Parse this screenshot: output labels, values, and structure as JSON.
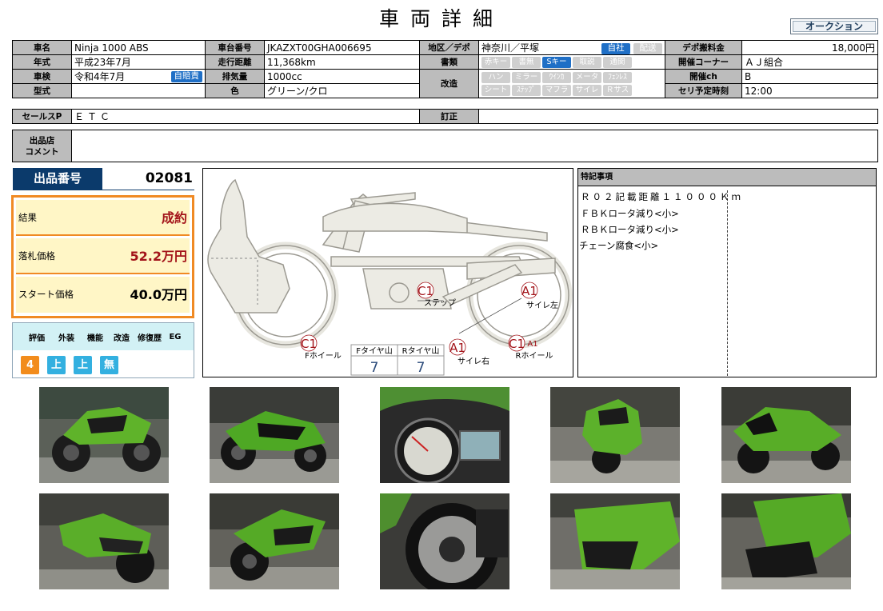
{
  "header": {
    "title": "車両詳細",
    "auction_button": "オークション"
  },
  "spec": {
    "name_label": "車名",
    "name": "Ninja 1000 ABS",
    "chassis_label": "車台番号",
    "chassis": "JKAZXT00GHA006695",
    "region_label": "地区／デポ",
    "region": "神奈川／平塚",
    "own_tag": "自社",
    "delivery_tag": "配送",
    "depo_fee_label": "デポ搬料金",
    "depo_fee": "18,000円",
    "year_label": "年式",
    "year": "平成23年7月",
    "mileage_label": "走行距離",
    "mileage": "11,368km",
    "docs_label": "書類",
    "docs_tags": [
      {
        "label": "赤キー",
        "on": false
      },
      {
        "label": "書無",
        "on": false
      },
      {
        "label": "Sキー",
        "on": true
      },
      {
        "label": "取説",
        "on": false
      },
      {
        "label": "通関",
        "on": false
      }
    ],
    "corner_label": "開催コーナー",
    "corner": "ＡＪ組合",
    "inspection_label": "車検",
    "inspection": "令和4年7月",
    "insurance_tag": "自賠責",
    "displacement_label": "排気量",
    "displacement": "1000cc",
    "mod_label": "改造",
    "mod_tags_row1": [
      "ハン",
      "ミラー",
      "ｳｲﾝｶ",
      "メータ",
      "ﾌｪﾝﾚｽ"
    ],
    "mod_tags_row2": [
      "シート",
      "ｽﾃｯﾌﾟ",
      "マフラ",
      "サイレ",
      "Ｒサス"
    ],
    "channel_label": "開催ch",
    "channel": "B",
    "model_label": "型式",
    "model": "",
    "color_label": "色",
    "color": "グリーン/クロ",
    "auction_time_label": "セリ予定時刻",
    "auction_time": "12:00",
    "sales_label": "セールスP",
    "sales": "ＥＴＣ",
    "correction_label": "訂正",
    "correction": "",
    "comment_label_1": "出品店",
    "comment_label_2": "コメント",
    "comment": ""
  },
  "lot": {
    "label": "出品番号",
    "number": "02081"
  },
  "result": {
    "result_label": "結果",
    "result_value": "成約",
    "price_label": "落札価格",
    "price": "52.2万円",
    "start_label": "スタート価格",
    "start": "40.0万円"
  },
  "grades": {
    "headers": [
      "評価",
      "外装",
      "機能",
      "改造",
      "修復歴",
      "EG"
    ],
    "values": [
      {
        "label": "4",
        "color": "#f28c1c"
      },
      {
        "label": "上",
        "color": "#33b0e0"
      },
      {
        "label": "上",
        "color": "#33b0e0"
      },
      {
        "label": "無",
        "color": "#33b0e0"
      }
    ]
  },
  "diagram": {
    "marks": [
      {
        "code": "C1",
        "label": "ステップ"
      },
      {
        "code": "A1",
        "label": "サイレ左"
      },
      {
        "code": "C1",
        "label": "Fホイール"
      },
      {
        "code": "A1",
        "label": "サイレ右"
      },
      {
        "code": "C1",
        "sub": "A1",
        "label": "Rホイール"
      }
    ],
    "tires": {
      "front_label": "Fタイヤ山",
      "front": "7",
      "rear_label": "Rタイヤ山",
      "rear": "7"
    }
  },
  "notes": {
    "title": "特記事項",
    "lines": [
      "Ｒ０２記載距離１１０００Ｋｍ",
      "ＦＢＫロータ減り<小>",
      "ＲＢＫロータ減り<小>",
      "チェーン腐食<小>"
    ]
  },
  "photos": [
    {
      "icon": "motorcycle-side-photo"
    },
    {
      "icon": "motorcycle-front-photo"
    },
    {
      "icon": "meter-photo"
    },
    {
      "icon": "motorcycle-front-photo"
    },
    {
      "icon": "motorcycle-front-photo"
    },
    {
      "icon": "motorcycle-rear-photo"
    },
    {
      "icon": "motorcycle-rear-photo"
    },
    {
      "icon": "brake-disc-photo"
    },
    {
      "icon": "fairing-photo"
    },
    {
      "icon": "fairing-photo"
    }
  ],
  "colors": {
    "navy": "#0b3a6b",
    "orange": "#f08a24",
    "cream": "#fff6c6",
    "blue_tag": "#1f6fc6",
    "grade_cyan": "#d2f1f5",
    "green": "#5fb32a"
  }
}
